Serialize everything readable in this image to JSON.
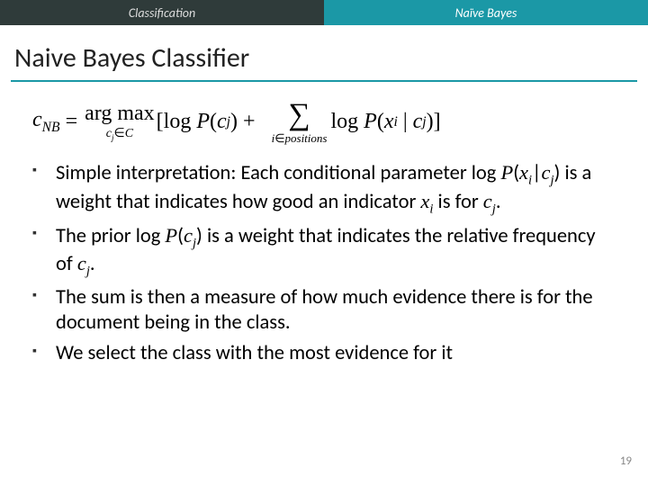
{
  "header": {
    "left": "Classification",
    "right": "Naïve Bayes"
  },
  "title": "Naive Bayes Classifier",
  "formula": {
    "lhs_var": "c",
    "lhs_sub": "NB",
    "argmax_label": "arg max",
    "argmax_sub_var": "c",
    "argmax_sub_set": "C",
    "log_text": "log",
    "P": "P",
    "cj_var": "c",
    "cj_sub": "j",
    "sum_sub_var": "i",
    "sum_sub_set": "positions",
    "xi_var": "x",
    "xi_sub": "i"
  },
  "bullets": [
    {
      "pre": "Simple interpretation: Each conditional parameter log ",
      "math": "P(x_i|c_j)",
      "mid": " is a weight that indicates how good an indicator ",
      "math2": "x_i",
      "mid2": " is for ",
      "math3": "c_j",
      "post": "."
    },
    {
      "pre": "The prior log ",
      "math": "P(c_j)",
      "mid": " is a weight that indicates the relative frequency of ",
      "math2": "c_j",
      "post": "."
    },
    {
      "pre": "The sum is then a measure of how much evidence there is for the document being in the class."
    },
    {
      "pre": "We select the class with the most evidence for it"
    }
  ],
  "page_number": "19"
}
